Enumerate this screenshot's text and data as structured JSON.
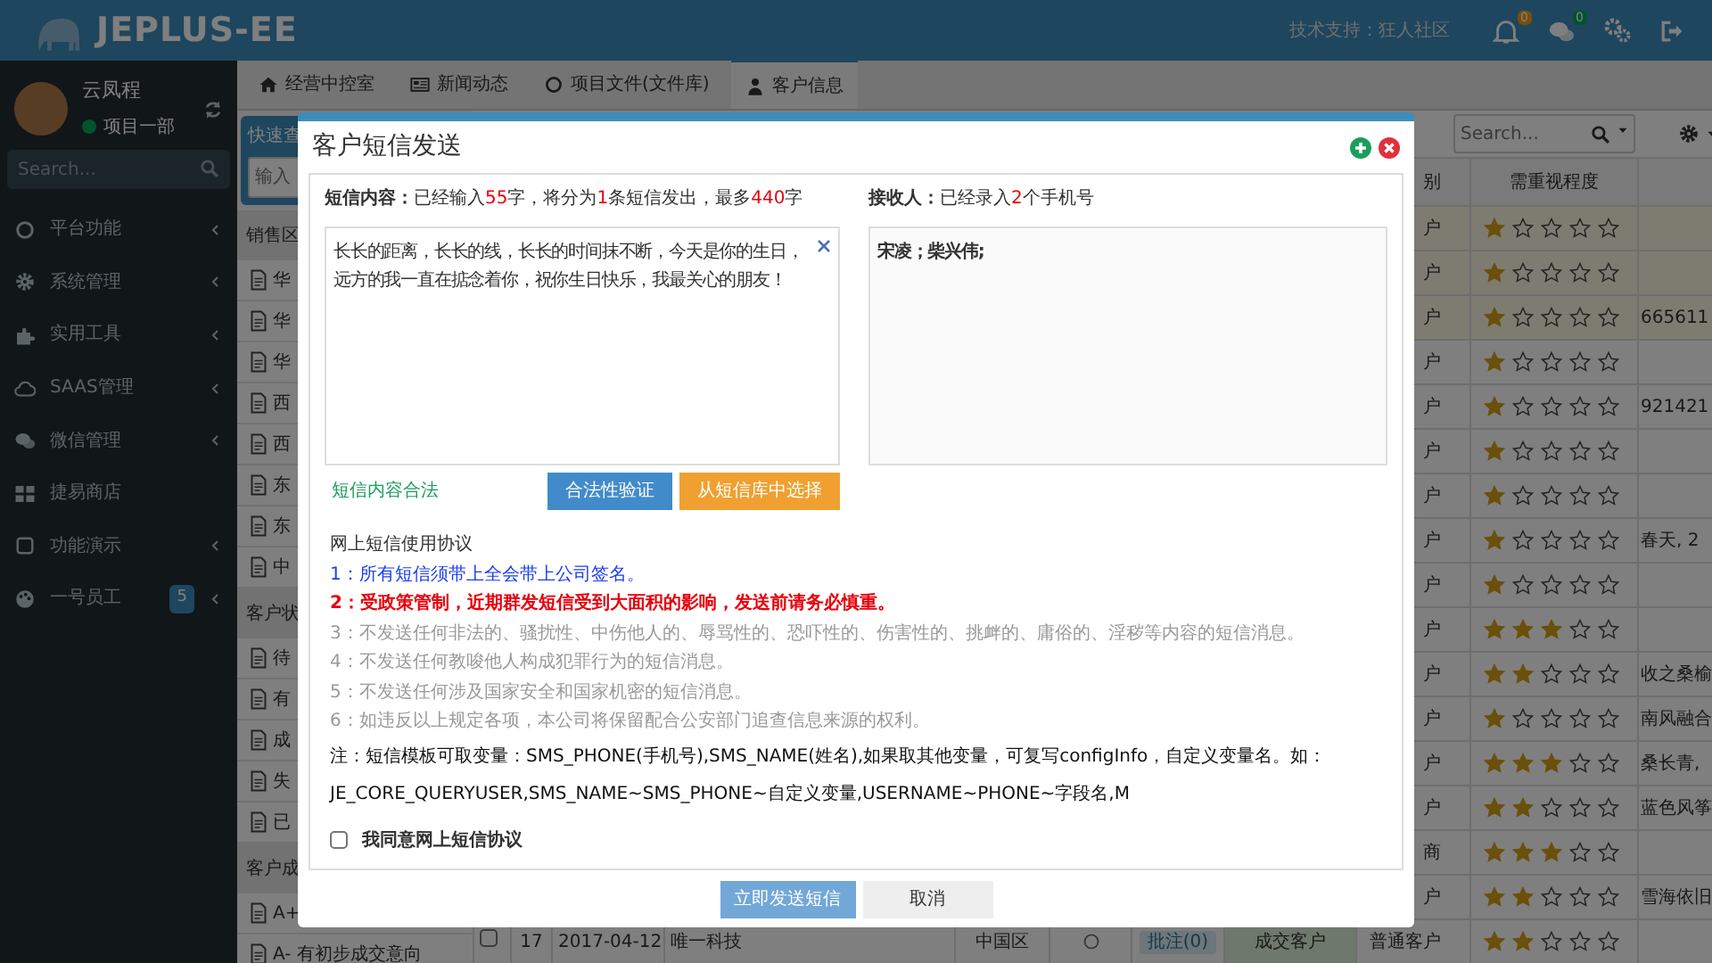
{
  "header": {
    "logo": "JEPLUS-EE",
    "support": "技术支持：狂人社区",
    "alerts": [
      {
        "kind": "bell",
        "badge": "0"
      },
      {
        "kind": "chat",
        "badge": "0"
      }
    ]
  },
  "user": {
    "name": "云凤程",
    "status": "项目一部",
    "online": true
  },
  "sidebar": {
    "search_placeholder": "Search...",
    "items": [
      {
        "kind": "circle",
        "label": "平台功能",
        "expandable": true
      },
      {
        "kind": "gear",
        "label": "系统管理",
        "expandable": true
      },
      {
        "kind": "puzzle",
        "label": "实用工具",
        "expandable": true
      },
      {
        "kind": "cloud",
        "label": "SAAS管理",
        "expandable": true
      },
      {
        "kind": "chat",
        "label": "微信管理",
        "expandable": true
      },
      {
        "kind": "grid",
        "label": "捷易商店",
        "expandable": false
      },
      {
        "kind": "square",
        "label": "功能演示",
        "expandable": true
      },
      {
        "kind": "palette",
        "label": "一号员工",
        "badge": "5",
        "expandable": true
      }
    ]
  },
  "tabs": [
    {
      "kind": "home",
      "label": "经营中控室",
      "selected": false
    },
    {
      "kind": "news",
      "label": "新闻动态",
      "selected": false
    },
    {
      "kind": "circle",
      "label": "项目文件(文件库)",
      "selected": false
    },
    {
      "kind": "user",
      "label": "客户信息",
      "selected": true
    }
  ],
  "quick_search": {
    "title": "快速查",
    "placeholder": "输入"
  },
  "tree": [
    {
      "title": "销售区",
      "items": [
        "华",
        "华",
        "华",
        "西",
        "西",
        "东",
        "东",
        "中"
      ]
    },
    {
      "title": "客户状",
      "items": [
        "待",
        "有",
        "成",
        "失",
        "已"
      ]
    },
    {
      "title": "客户成",
      "items": [
        "A+",
        "A- 有初步成交意向"
      ]
    }
  ],
  "table": {
    "search_placeholder": "Search...",
    "columns": [
      "别",
      "需重视程度"
    ],
    "rows": [
      {
        "highlighted": true,
        "category": "户",
        "stars": 1
      },
      {
        "highlighted": true,
        "category": "户",
        "stars": 1
      },
      {
        "highlighted": true,
        "category": "户",
        "stars": 1,
        "extra": "665611"
      },
      {
        "highlighted": false,
        "category": "户",
        "stars": 1
      },
      {
        "highlighted": false,
        "category": "户",
        "stars": 1,
        "extra": "921421"
      },
      {
        "highlighted": false,
        "category": "户",
        "stars": 1
      },
      {
        "highlighted": false,
        "category": "户",
        "stars": 1
      },
      {
        "highlighted": false,
        "category": "户",
        "stars": 1,
        "extra": "春天, 2"
      },
      {
        "highlighted": false,
        "category": "户",
        "stars": 1
      },
      {
        "highlighted": false,
        "category": "户",
        "stars": 3
      },
      {
        "highlighted": false,
        "category": "户",
        "stars": 2,
        "extra": "收之桑榆"
      },
      {
        "highlighted": false,
        "category": "户",
        "stars": 1,
        "extra": "南风融合"
      },
      {
        "highlighted": false,
        "category": "户",
        "stars": 3,
        "extra": "桑长青,"
      },
      {
        "highlighted": false,
        "category": "户",
        "stars": 2,
        "extra": "蓝色风筝"
      },
      {
        "highlighted": false,
        "category": "商",
        "stars": 3
      },
      {
        "highlighted": false,
        "category": "户",
        "stars": 2,
        "extra": "雪海依旧"
      },
      {
        "highlighted": false,
        "checked": false,
        "number": "17",
        "date": "2017-04-12",
        "company": "唯一科技",
        "region": "中国区",
        "note": "批注(0)",
        "status": "成交客户",
        "category": "普通客户",
        "stars": 2
      }
    ]
  },
  "modal": {
    "title": "客户短信发送",
    "content_label": "短信内容：",
    "content_count": [
      {
        "text": "已经输入",
        "emphasis": false
      },
      {
        "text": "55",
        "emphasis": true
      },
      {
        "text": "字，将分为",
        "emphasis": false
      },
      {
        "text": "1",
        "emphasis": true
      },
      {
        "text": "条短信发出，最多",
        "emphasis": false
      },
      {
        "text": "440",
        "emphasis": true
      },
      {
        "text": "字",
        "emphasis": false
      }
    ],
    "message": "长长的距离，长长的线，长长的时间抹不断，今天是你的生日，远方的我一直在掂念着你，祝你生日快乐，我最关心的朋友！",
    "validity": "短信内容合法",
    "buttons": [
      {
        "label": "合法性验证",
        "kind": "primary"
      },
      {
        "label": "从短信库中选择",
        "kind": "warning"
      }
    ],
    "recipients_label": "接收人：",
    "recipients_count": [
      {
        "text": "已经录入",
        "emphasis": false
      },
      {
        "text": "2",
        "emphasis": true
      },
      {
        "text": "个手机号",
        "emphasis": false
      }
    ],
    "recipients": "宋凌；柴兴伟;",
    "agreement_title": "网上短信使用协议",
    "rules": [
      {
        "text": "1：所有短信须带上全会带上公司签名。",
        "kind": "info"
      },
      {
        "text": "2：受政策管制，近期群发短信受到大面积的影响，发送前请务必慎重。",
        "kind": "danger"
      },
      {
        "text": "3：不发送任何非法的、骚扰性、中伤他人的、辱骂性的、恐吓性的、伤害性的、挑衅的、庸俗的、淫秽等内容的短信消息。",
        "kind": "muted"
      },
      {
        "text": "4：不发送任何教唆他人构成犯罪行为的短信消息。",
        "kind": "muted"
      },
      {
        "text": "5：不发送任何涉及国家安全和国家机密的短信消息。",
        "kind": "muted"
      },
      {
        "text": "6：如违反以上规定各项，本公司将保留配合公安部门追查信息来源的权利。",
        "kind": "muted"
      }
    ],
    "note": "注：短信模板可取变量：SMS_PHONE(手机号),SMS_NAME(姓名),如果取其他变量，可复写configInfo，自定义变量名。如：\nJE_CORE_QUERYUSER,SMS_NAME~SMS_PHONE~自定义变量,USERNAME~PHONE~字段名,M",
    "consent": {
      "label": "我同意网上短信协议",
      "checked": false
    },
    "footer_buttons": [
      {
        "label": "立即发送短信",
        "kind": "primary",
        "disabled": true
      },
      {
        "label": "取消",
        "kind": "default",
        "disabled": false
      }
    ]
  }
}
